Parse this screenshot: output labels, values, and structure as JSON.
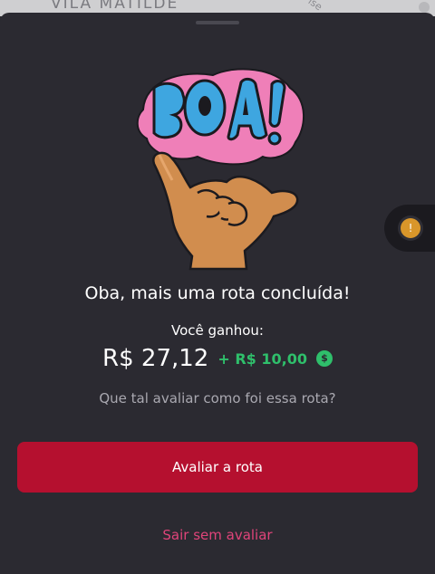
{
  "map": {
    "street_label": "VILA MATILDE",
    "side_label": "ise"
  },
  "sticker": {
    "text": "BOA!",
    "icon": "shaka-hand-icon"
  },
  "side_widget": {
    "icon": "coin-icon",
    "glyph": "!",
    "color": "#d9962a"
  },
  "result": {
    "headline": "Oba, mais uma rota concluída!",
    "earned_label": "Você ganhou:",
    "amount": "R$ 27,12",
    "bonus": "+ R$ 10,00",
    "bonus_icon_glyph": "$",
    "question": "Que tal avaliar como foi essa rota?"
  },
  "actions": {
    "rate_label": "Avaliar a rota",
    "skip_label": "Sair sem avaliar"
  },
  "colors": {
    "background": "#2b2a31",
    "primary": "#b5102f",
    "bonus": "#2fbf6b",
    "link": "#e0447a"
  }
}
